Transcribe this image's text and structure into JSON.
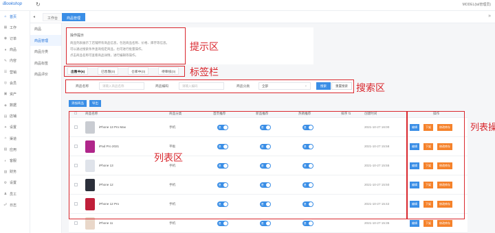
{
  "topbar": {
    "logo": "iBookshop",
    "refresh_icon": "↻",
    "right_text": "MODEL(tal管理员)"
  },
  "leftnav": {
    "items": [
      {
        "icon": "⌂",
        "label": "首页",
        "active": true
      },
      {
        "icon": "▦",
        "label": "工作"
      },
      {
        "icon": "◉",
        "label": "订单"
      },
      {
        "icon": "♦",
        "label": "商品"
      },
      {
        "icon": "✎",
        "label": "内容"
      },
      {
        "icon": "☰",
        "label": "营销"
      },
      {
        "icon": "◎",
        "label": "会员"
      },
      {
        "icon": "▣",
        "label": "资产"
      },
      {
        "icon": "◈",
        "label": "数据"
      },
      {
        "icon": "▤",
        "label": "店铺"
      },
      {
        "icon": "✦",
        "label": "设置"
      },
      {
        "icon": "✧",
        "label": "渠道"
      },
      {
        "icon": "▧",
        "label": "应用"
      },
      {
        "icon": "◐",
        "label": "客服"
      },
      {
        "icon": "▨",
        "label": "财务"
      },
      {
        "icon": "⚙",
        "label": "设置"
      },
      {
        "icon": "♟",
        "label": "员工"
      },
      {
        "icon": "☍",
        "label": "日志"
      }
    ]
  },
  "tabbar": {
    "back_arrow": "◂",
    "tabs": [
      {
        "label": "工作台"
      },
      {
        "label": "商品管理",
        "active": true
      }
    ],
    "more_icon": "»"
  },
  "subnav": {
    "items": [
      {
        "label": "商品"
      },
      {
        "label": "商品管理",
        "active": true
      },
      {
        "label": "商品分类"
      },
      {
        "label": "商品标签"
      },
      {
        "label": "商品评价"
      }
    ]
  },
  "notice": {
    "title": "操作提示",
    "lines": [
      "商品列表展示了店铺所有商品信息，包括商品名称、价格、库存等信息。",
      "可以通过搜索条件查询指定商品，也可进行批量操作。",
      "点击商品名称可查看商品详情，进行编辑等操作。"
    ]
  },
  "filters": {
    "tabs": [
      {
        "label": "出售中(6)",
        "active": true
      },
      {
        "label": "已售罄(0)"
      },
      {
        "label": "仓库中(0)"
      },
      {
        "label": "待审核(0)"
      }
    ]
  },
  "search": {
    "name_label": "商品名称",
    "name_placeholder": "请输入商品名称",
    "code_label": "商品编码",
    "code_placeholder": "请输入编码",
    "cat_label": "商品分类",
    "cat_value": "全部",
    "search_btn": "搜索",
    "reset_btn": "重置搜索"
  },
  "actions": {
    "add": "添加商品",
    "export": "导出"
  },
  "table": {
    "headers": [
      "商品名称",
      "商品分类",
      "首页推荐",
      "新品推荐",
      "热销推荐",
      "排序 ⇅",
      "创建时间",
      "操作"
    ],
    "rows": [
      {
        "name": "iPhone 13 Pro Max",
        "cat": "手机",
        "time": "2021-10-27 16:00",
        "color": "#c9ccd2"
      },
      {
        "name": "iPad Pro 2021",
        "cat": "平板",
        "time": "2021-10-27 15:58",
        "color": "#b0268a"
      },
      {
        "name": "iPhone 13",
        "cat": "手机",
        "time": "2021-10-27 15:55",
        "color": "#dfe3ea"
      },
      {
        "name": "iPhone 12",
        "cat": "手机",
        "time": "2021-10-27 15:50",
        "color": "#2b2f3a"
      },
      {
        "name": "iPhone 12 Pro",
        "cat": "手机",
        "time": "2021-10-27 15:42",
        "color": "#c01f3a"
      },
      {
        "name": "iPhone 11",
        "cat": "手机",
        "time": "2021-10-27 15:35",
        "color": "#e9d7c9"
      }
    ],
    "toggle_text": "是",
    "btn_edit": "编辑",
    "btn_off": "下架",
    "btn_stock": "修改库存"
  },
  "annotations": {
    "notice": "提示区",
    "tabs": "标签栏",
    "search": "搜索区",
    "list": "列表区",
    "ops": "列表操作区"
  }
}
